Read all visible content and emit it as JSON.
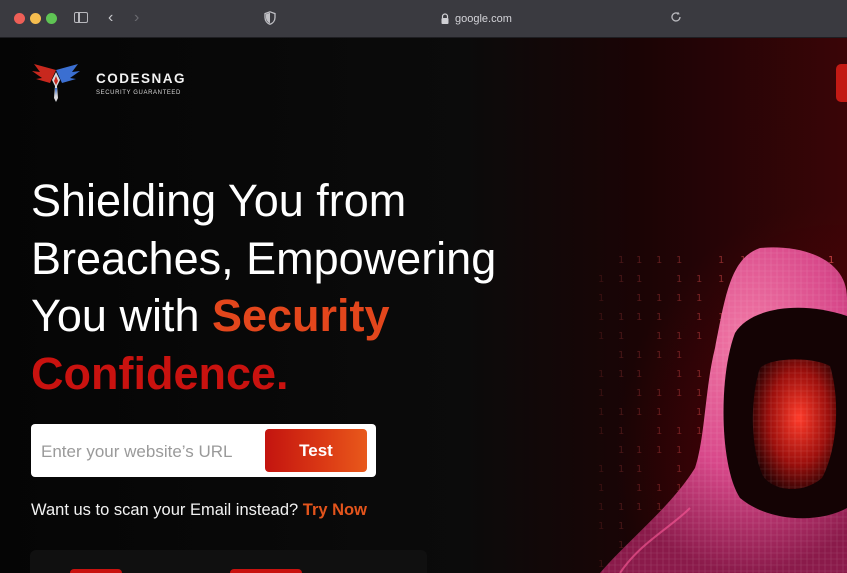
{
  "browser": {
    "url": "google.com",
    "icons": [
      "sidebar-icon",
      "back-chevron-icon",
      "forward-chevron-icon",
      "shield-icon",
      "lock-icon",
      "reload-icon"
    ]
  },
  "brand": {
    "name": "CODESNAG",
    "tagline": "SECURITY GUARANTEED"
  },
  "hero": {
    "line1": "Shielding You from",
    "line2": "Breaches, Empowering",
    "line3_plain": "You with ",
    "line3_accent": "Security",
    "line4_accent": "Confidence."
  },
  "scan_form": {
    "placeholder": "Enter your website’s URL",
    "button_label": "Test"
  },
  "email_prompt": {
    "text": "Want us to scan your Email instead? ",
    "link": "Try Now"
  },
  "colors": {
    "accent_orange": "#e3461c",
    "accent_red": "#c9120f",
    "background": "#000000"
  }
}
